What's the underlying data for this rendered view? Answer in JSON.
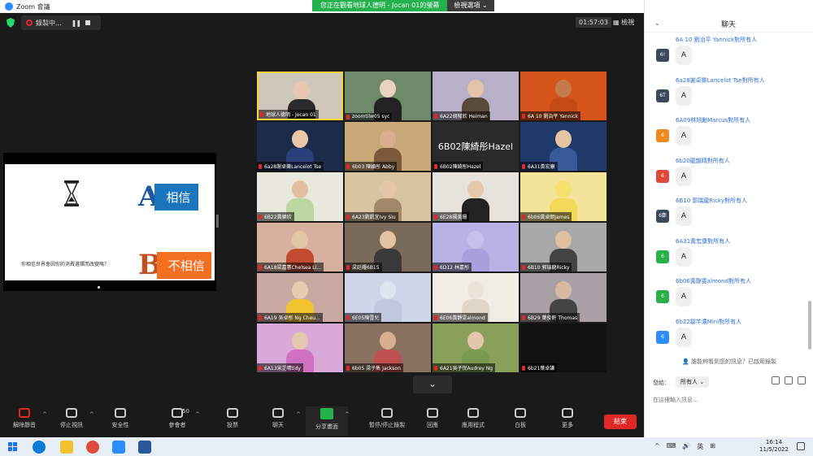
{
  "window": {
    "app_title": "Zoom 會議",
    "share_banner": "您正在觀看地球人德明 - Jocan 01的螢幕",
    "view_options": "檢視選項 ⌄",
    "controls": [
      "—",
      "❐",
      "✕"
    ]
  },
  "header": {
    "recording_label": "錄製中...",
    "timer": "01:57:03",
    "view_label": "檢視"
  },
  "slide": {
    "option_a_letter": "A",
    "option_a_text": "相信",
    "option_b_letter": "B",
    "option_b_text": "不相信",
    "question": "你相信世界會因你的消費選擇而改變嗎？"
  },
  "participants": [
    {
      "name": "地球人德明 - Jocan 01",
      "bg": "#cfc6bc",
      "skin": "#e8c8b0",
      "shirt": "#2b2b2b",
      "active": true
    },
    {
      "name": "zoomtilw05 syc",
      "bg": "#6e8a6a",
      "skin": "#e9d3c2",
      "shirt": "#222"
    },
    {
      "name": "6A22胡郁欣 Heiman",
      "bg": "#b8b0c8",
      "skin": "#e3c4a8",
      "shirt": "#5a4a3a"
    },
    {
      "name": "6A 10 劉治平 Yannick",
      "bg": "#d4541c",
      "skin": "#c47a4a",
      "shirt": "#c44a14"
    },
    {
      "name": "6a28謝卓樂Lancelot Tse",
      "bg": "#1d2b4a",
      "skin": "#e8c8a8",
      "shirt": "#2a3f7a"
    },
    {
      "name": "6b03 陳穎彤 Abby",
      "bg": "#c9a97a",
      "skin": "#d8b090",
      "shirt": "#7a5a3a"
    },
    {
      "name": "6B02陳綺彤Hazel",
      "bg": "#2a2a2a",
      "avatar_text": "6B02陳綺彤Hazel"
    },
    {
      "name": "6A31黃宏康",
      "bg": "#1f3a6a",
      "skin": "#e6c5a3",
      "shirt": "#365a9a"
    },
    {
      "name": "6B22黃樂欣",
      "bg": "#e8e8dc",
      "skin": "#e0c0a0",
      "shirt": "#bcd8a0"
    },
    {
      "name": "6A23劉凱宜Ivy Siu",
      "bg": "#d8c4a0",
      "skin": "#e4c6a8",
      "shirt": "#a08868"
    },
    {
      "name": "6E28楊美珊",
      "bg": "#e6e2dc",
      "skin": "#e6c8aa",
      "shirt": "#222"
    },
    {
      "name": "6b06黃卓朗James",
      "bg": "#f3e49a",
      "skin": "#f6e070",
      "shirt": "#f3d85a"
    },
    {
      "name": "6A18梁嘉蕙Chelsea Li...",
      "bg": "#d8b0a0",
      "skin": "#e4c4a4",
      "shirt": "#c24a30"
    },
    {
      "name": "梁廷耀6B15",
      "bg": "#7a6a5a",
      "skin": "#e2c2a2",
      "shirt": "#3a3a3a"
    },
    {
      "name": "6D12 林嘉彤",
      "bg": "#b9b2e4",
      "skin": "#c8c0ec",
      "shirt": "#a8a0dc"
    },
    {
      "name": "6B10 郭瑞龍Ricky",
      "bg": "#a8a8a8",
      "skin": "#e0c0a0",
      "shirt": "#444"
    },
    {
      "name": "6A19 吳卓彤 Ng Cheu...",
      "bg": "#c8a8a0",
      "skin": "#e8cbb0",
      "shirt": "#f2c430"
    },
    {
      "name": "6E05陳雪兒",
      "bg": "#cfd6ea",
      "skin": "#dfe4f2",
      "shirt": "#c0c8e0"
    },
    {
      "name": "6E06黃靜雯almond",
      "bg": "#f1ece4",
      "skin": "#ece4d8",
      "shirt": "#e0d6c8"
    },
    {
      "name": "6B29 葉俊軒 Thomas",
      "bg": "#a8a0a4",
      "skin": "#d8b8a0",
      "shirt": "#444"
    },
    {
      "name": "6A13宋芷晴tidy",
      "bg": "#d8a8d8",
      "skin": "#e6c6ae",
      "shirt": "#d070c0"
    },
    {
      "name": "6b05 梁子雋 Jackson",
      "bg": "#8a7060",
      "skin": "#d8b090",
      "shirt": "#c05050"
    },
    {
      "name": "6A21吳子悅Audrey Ng",
      "bg": "#8aa05a",
      "skin": "#e4c6aa",
      "shirt": "#7a9a50"
    },
    {
      "name": "6b21葉卓謙",
      "bg": "#111111",
      "skin": "#111",
      "shirt": "#111"
    }
  ],
  "chat": {
    "title": "聊天",
    "collapse": "⌄",
    "messages": [
      {
        "from": "6A 10 劉治平 Yannick對所有人",
        "avatar": "6!",
        "avatar_color": "#3a4a5a",
        "text": "A"
      },
      {
        "from": "6a28謝卓樂Lancelot Tse對所有人",
        "avatar": "6T",
        "avatar_color": "#3a4a5a",
        "text": "A"
      },
      {
        "from": "6A09林旭勳Marcus對所有人",
        "avatar": "6",
        "avatar_color": "#f08a1c",
        "text": "A"
      },
      {
        "from": "6b20龍韻晴對所有人",
        "avatar": "6",
        "avatar_color": "#e04a3a",
        "text": "A"
      },
      {
        "from": "6B10 郭瑞龍Ricky對所有人",
        "avatar": "6鄭",
        "avatar_color": "#3a4a5a",
        "text": "A"
      },
      {
        "from": "6A31黃宏康對所有人",
        "avatar": "6",
        "avatar_color": "#2ab04a",
        "text": "A"
      },
      {
        "from": "6b06黃靜雯almond對所有人",
        "avatar": "6",
        "avatar_color": "#2ab04a",
        "text": "A"
      },
      {
        "from": "6b22鄒芊濃Mini對所有人",
        "avatar": "6",
        "avatar_color": "#2d8cff",
        "text": "A"
      }
    ],
    "notice": "誰能夠看到您的訊息？已啟用錄製",
    "send_to_label": "發給：",
    "send_to_value": "所有人 ⌄",
    "input_placeholder": "在這裡輸入訊息..."
  },
  "toolbar": {
    "items": [
      {
        "label": "解除靜音",
        "icon": "mic-muted-icon"
      },
      {
        "label": "停止視訊",
        "icon": "video-camera-icon"
      },
      {
        "label": "安全性",
        "icon": "shield-icon"
      },
      {
        "label": "參會者",
        "icon": "participants-icon",
        "badge": "50"
      },
      {
        "label": "投票",
        "icon": "poll-icon"
      },
      {
        "label": "聊天",
        "icon": "chat-icon"
      },
      {
        "label": "分享畫面",
        "icon": "share-screen-icon"
      },
      {
        "label": "暫停/停止錄製",
        "icon": "pause-record-icon"
      },
      {
        "label": "回應",
        "icon": "reactions-icon"
      },
      {
        "label": "應用程式",
        "icon": "apps-icon"
      },
      {
        "label": "白板",
        "icon": "whiteboard-icon"
      },
      {
        "label": "更多",
        "icon": "more-icon"
      }
    ],
    "end_label": "結束"
  },
  "taskbar": {
    "tray": [
      "^",
      "⌨",
      "🔊",
      "英",
      "⊞"
    ],
    "time": "16:14",
    "date": "11/5/2022"
  }
}
